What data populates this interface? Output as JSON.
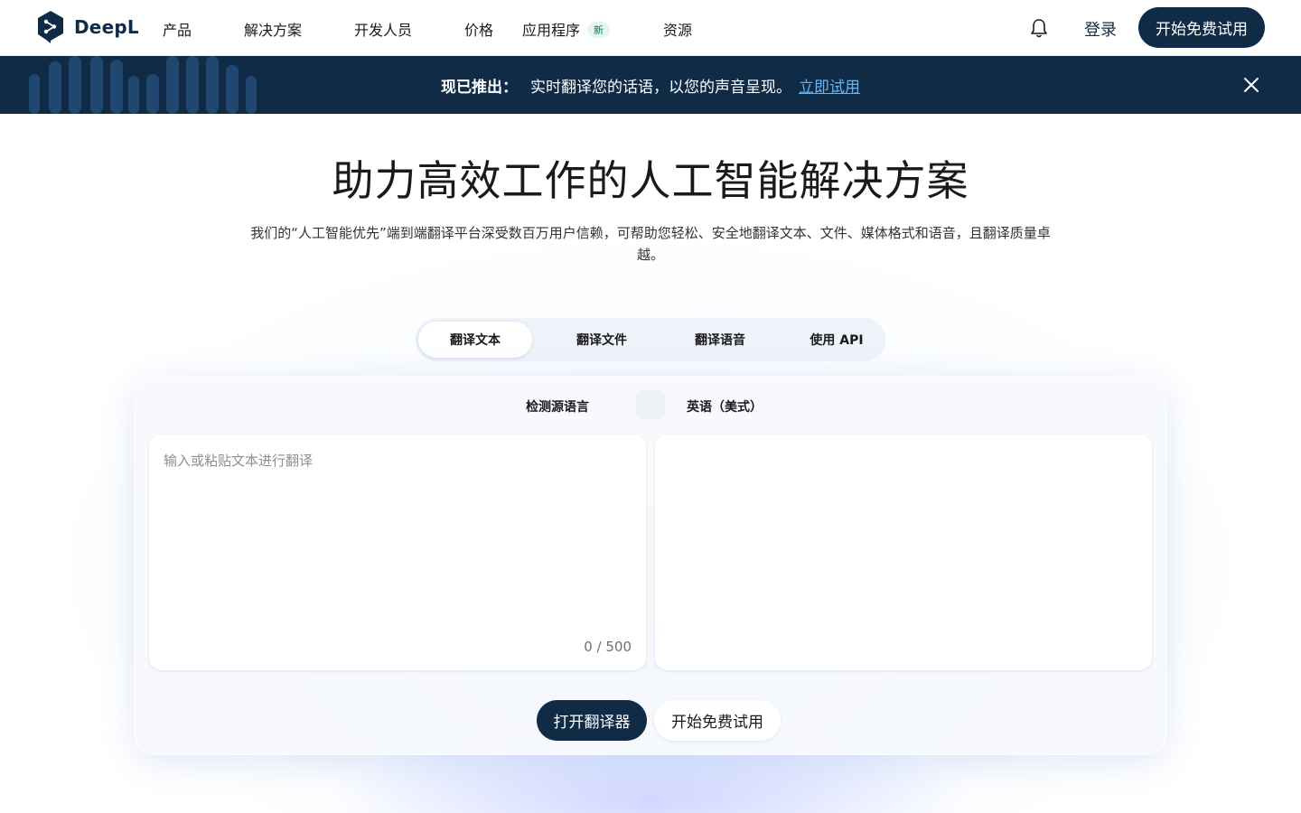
{
  "brand": {
    "name": "DeepL",
    "color": "#0f2b46"
  },
  "nav": {
    "items": [
      {
        "label": "产品"
      },
      {
        "label": "解决方案"
      },
      {
        "label": "开发人员"
      },
      {
        "label": "价格"
      },
      {
        "label": "应用程序",
        "badge": "新"
      },
      {
        "label": "资源"
      }
    ],
    "bell_icon": "bell-icon",
    "login": "登录",
    "cta": "开始免费试用"
  },
  "banner": {
    "strong": "现已推出：",
    "text": "实时翻译您的话语，以您的声音呈现。",
    "link": "立即试用",
    "close_icon": "close-icon"
  },
  "hero": {
    "title": "助力高效工作的人工智能解决方案",
    "subtitle": "我们的“人工智能优先”端到端翻译平台深受数百万用户信赖，可帮助您轻松、安全地翻译文本、文件、媒体格式和语音，且翻译质量卓越。"
  },
  "tabs": [
    {
      "label": "翻译文本",
      "active": true
    },
    {
      "label": "翻译文件",
      "active": false
    },
    {
      "label": "翻译语音",
      "active": false
    },
    {
      "label": "使用 API",
      "active": false
    }
  ],
  "translator": {
    "source_lang": "检测源语言",
    "target_lang": "英语（美式）",
    "placeholder": "输入或粘贴文本进行翻译",
    "value": "",
    "counter": "0 / 500"
  },
  "actions": {
    "open": "打开翻译器",
    "trial": "开始免费试用"
  }
}
